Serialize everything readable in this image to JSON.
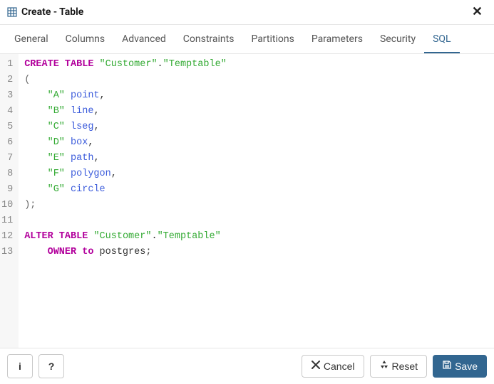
{
  "header": {
    "title": "Create - Table",
    "close_label": "✕"
  },
  "tabs": {
    "items": [
      {
        "label": "General"
      },
      {
        "label": "Columns"
      },
      {
        "label": "Advanced"
      },
      {
        "label": "Constraints"
      },
      {
        "label": "Partitions"
      },
      {
        "label": "Parameters"
      },
      {
        "label": "Security"
      },
      {
        "label": "SQL"
      }
    ],
    "active_index": 7
  },
  "footer": {
    "info_label": "i",
    "help_label": "?",
    "cancel_label": "Cancel",
    "reset_label": "Reset",
    "save_label": "Save"
  },
  "sql": {
    "lines": [
      {
        "n": 1,
        "tokens": [
          {
            "t": "kw",
            "v": "CREATE TABLE"
          },
          {
            "t": "plain",
            "v": " "
          },
          {
            "t": "str",
            "v": "\"Customer\""
          },
          {
            "t": "plain",
            "v": "."
          },
          {
            "t": "str",
            "v": "\"Temptable\""
          }
        ]
      },
      {
        "n": 2,
        "tokens": [
          {
            "t": "punct",
            "v": "("
          }
        ]
      },
      {
        "n": 3,
        "tokens": [
          {
            "t": "plain",
            "v": "    "
          },
          {
            "t": "str",
            "v": "\"A\""
          },
          {
            "t": "plain",
            "v": " "
          },
          {
            "t": "type",
            "v": "point"
          },
          {
            "t": "plain",
            "v": ","
          }
        ]
      },
      {
        "n": 4,
        "tokens": [
          {
            "t": "plain",
            "v": "    "
          },
          {
            "t": "str",
            "v": "\"B\""
          },
          {
            "t": "plain",
            "v": " "
          },
          {
            "t": "type",
            "v": "line"
          },
          {
            "t": "plain",
            "v": ","
          }
        ]
      },
      {
        "n": 5,
        "tokens": [
          {
            "t": "plain",
            "v": "    "
          },
          {
            "t": "str",
            "v": "\"C\""
          },
          {
            "t": "plain",
            "v": " "
          },
          {
            "t": "type",
            "v": "lseg"
          },
          {
            "t": "plain",
            "v": ","
          }
        ]
      },
      {
        "n": 6,
        "tokens": [
          {
            "t": "plain",
            "v": "    "
          },
          {
            "t": "str",
            "v": "\"D\""
          },
          {
            "t": "plain",
            "v": " "
          },
          {
            "t": "type",
            "v": "box"
          },
          {
            "t": "plain",
            "v": ","
          }
        ]
      },
      {
        "n": 7,
        "tokens": [
          {
            "t": "plain",
            "v": "    "
          },
          {
            "t": "str",
            "v": "\"E\""
          },
          {
            "t": "plain",
            "v": " "
          },
          {
            "t": "type",
            "v": "path"
          },
          {
            "t": "plain",
            "v": ","
          }
        ]
      },
      {
        "n": 8,
        "tokens": [
          {
            "t": "plain",
            "v": "    "
          },
          {
            "t": "str",
            "v": "\"F\""
          },
          {
            "t": "plain",
            "v": " "
          },
          {
            "t": "type",
            "v": "polygon"
          },
          {
            "t": "plain",
            "v": ","
          }
        ]
      },
      {
        "n": 9,
        "tokens": [
          {
            "t": "plain",
            "v": "    "
          },
          {
            "t": "str",
            "v": "\"G\""
          },
          {
            "t": "plain",
            "v": " "
          },
          {
            "t": "type",
            "v": "circle"
          }
        ]
      },
      {
        "n": 10,
        "tokens": [
          {
            "t": "punct",
            "v": ");"
          }
        ]
      },
      {
        "n": 11,
        "tokens": [
          {
            "t": "plain",
            "v": ""
          }
        ]
      },
      {
        "n": 12,
        "tokens": [
          {
            "t": "kw",
            "v": "ALTER TABLE"
          },
          {
            "t": "plain",
            "v": " "
          },
          {
            "t": "str",
            "v": "\"Customer\""
          },
          {
            "t": "plain",
            "v": "."
          },
          {
            "t": "str",
            "v": "\"Temptable\""
          }
        ]
      },
      {
        "n": 13,
        "tokens": [
          {
            "t": "plain",
            "v": "    "
          },
          {
            "t": "kw2",
            "v": "OWNER to"
          },
          {
            "t": "plain",
            "v": " "
          },
          {
            "t": "ident",
            "v": "postgres"
          },
          {
            "t": "plain",
            "v": ";"
          }
        ]
      }
    ]
  }
}
